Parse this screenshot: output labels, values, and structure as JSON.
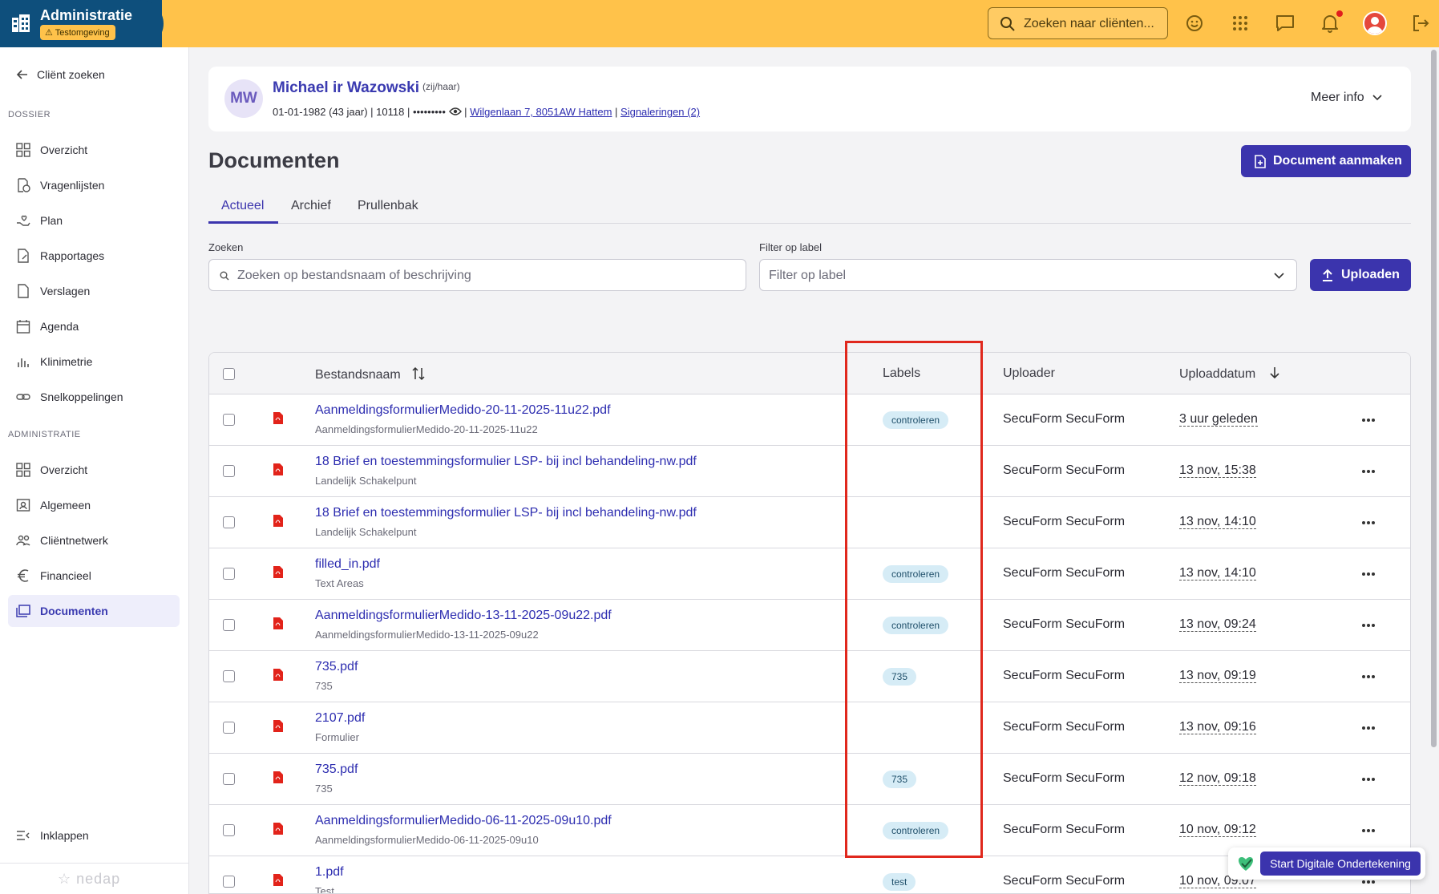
{
  "header": {
    "app_title": "Administratie",
    "env_badge": "Testomgeving",
    "search_placeholder": "Zoeken naar cliënten..."
  },
  "sidebar": {
    "back_label": "Cliënt zoeken",
    "section_dossier": "DOSSIER",
    "dossier_items": [
      {
        "label": "Overzicht",
        "icon": "grid-icon"
      },
      {
        "label": "Vragenlijsten",
        "icon": "questionnaire-icon"
      },
      {
        "label": "Plan",
        "icon": "hand-heart-icon"
      },
      {
        "label": "Rapportages",
        "icon": "report-icon"
      },
      {
        "label": "Verslagen",
        "icon": "document-icon"
      },
      {
        "label": "Agenda",
        "icon": "calendar-icon"
      },
      {
        "label": "Klinimetrie",
        "icon": "bar-chart-icon"
      },
      {
        "label": "Snelkoppelingen",
        "icon": "link-icon"
      }
    ],
    "section_admin": "ADMINISTRATIE",
    "admin_items": [
      {
        "label": "Overzicht",
        "icon": "grid-icon"
      },
      {
        "label": "Algemeen",
        "icon": "id-card-icon"
      },
      {
        "label": "Cliëntnetwerk",
        "icon": "people-icon"
      },
      {
        "label": "Financieel",
        "icon": "euro-icon"
      },
      {
        "label": "Documenten",
        "icon": "folders-icon"
      }
    ],
    "active_item": "Documenten",
    "collapse_label": "Inklappen",
    "vendor_logo": "nedap"
  },
  "client": {
    "initials": "MW",
    "name": "Michael ir Wazowski",
    "pronouns": "(zij/haar)",
    "birth": "01-01-1982 (43 jaar)",
    "client_number": "10118",
    "masked_bsn": "•••••••••",
    "address": "Wilgenlaan 7, 8051AW Hattem",
    "signals": "Signaleringen (2)",
    "more_info": "Meer info"
  },
  "page": {
    "title": "Documenten",
    "create_button": "Document aanmaken",
    "tabs": [
      "Actueel",
      "Archief",
      "Prullenbak"
    ],
    "active_tab": "Actueel",
    "search_label": "Zoeken",
    "search_placeholder": "Zoeken op bestandsnaam of beschrijving",
    "filter_label": "Filter op label",
    "filter_placeholder": "Filter op label",
    "upload_button": "Uploaden"
  },
  "table": {
    "columns": [
      "Bestandsnaam",
      "Labels",
      "Uploader",
      "Uploaddatum"
    ],
    "rows": [
      {
        "name": "AanmeldingsformulierMedido-20-11-2025-11u22.pdf",
        "desc": "AanmeldingsformulierMedido-20-11-2025-11u22",
        "label": "controleren",
        "uploader": "SecuForm SecuForm",
        "date": "3 uur geleden"
      },
      {
        "name": "18 Brief en toestemmingsformulier LSP- bij incl behandeling-nw.pdf",
        "desc": "Landelijk Schakelpunt",
        "label": "",
        "uploader": "SecuForm SecuForm",
        "date": "13 nov, 15:38"
      },
      {
        "name": "18 Brief en toestemmingsformulier LSP- bij incl behandeling-nw.pdf",
        "desc": "Landelijk Schakelpunt",
        "label": "",
        "uploader": "SecuForm SecuForm",
        "date": "13 nov, 14:10"
      },
      {
        "name": "filled_in.pdf",
        "desc": "Text Areas",
        "label": "controleren",
        "uploader": "SecuForm SecuForm",
        "date": "13 nov, 14:10"
      },
      {
        "name": "AanmeldingsformulierMedido-13-11-2025-09u22.pdf",
        "desc": "AanmeldingsformulierMedido-13-11-2025-09u22",
        "label": "controleren",
        "uploader": "SecuForm SecuForm",
        "date": "13 nov, 09:24"
      },
      {
        "name": "735.pdf",
        "desc": "735",
        "label": "735",
        "uploader": "SecuForm SecuForm",
        "date": "13 nov, 09:19"
      },
      {
        "name": "2107.pdf",
        "desc": "Formulier",
        "label": "",
        "uploader": "SecuForm SecuForm",
        "date": "13 nov, 09:16"
      },
      {
        "name": "735.pdf",
        "desc": "735",
        "label": "735",
        "uploader": "SecuForm SecuForm",
        "date": "12 nov, 09:18"
      },
      {
        "name": "AanmeldingsformulierMedido-06-11-2025-09u10.pdf",
        "desc": "AanmeldingsformulierMedido-06-11-2025-09u10",
        "label": "controleren",
        "uploader": "SecuForm SecuForm",
        "date": "10 nov, 09:12"
      },
      {
        "name": "1.pdf",
        "desc": "Test",
        "label": "test",
        "uploader": "SecuForm SecuForm",
        "date": "10 nov, 09:07"
      }
    ]
  },
  "sign_widget": {
    "label": "Start Digitale Ondertekening"
  },
  "colors": {
    "topbar": "#ffc24a",
    "brand": "#0e4f7c",
    "primary": "#3b34ad",
    "highlight": "#e0281d",
    "chip": "#d6ecf6"
  }
}
